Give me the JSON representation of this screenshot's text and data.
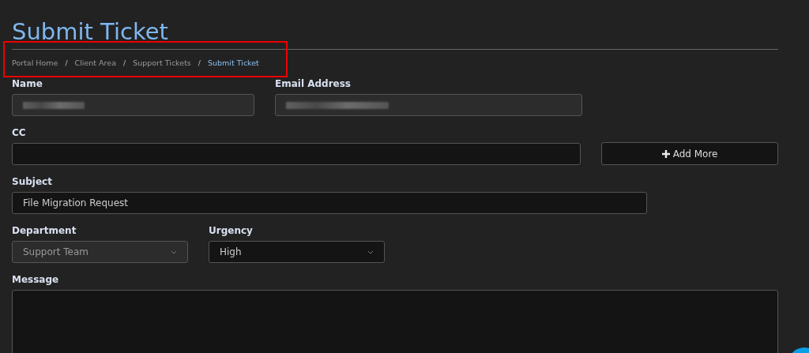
{
  "title": "Submit Ticket",
  "breadcrumb": [
    {
      "label": "Portal Home",
      "selected": false
    },
    {
      "label": "Client Area",
      "selected": false
    },
    {
      "label": "Support Tickets",
      "selected": false
    },
    {
      "label": "Submit Ticket",
      "selected": true
    }
  ],
  "breadcrumb_separator": "/",
  "form": {
    "name": {
      "label": "Name",
      "redacted": true
    },
    "email": {
      "label": "Email Address",
      "redacted": true
    },
    "cc": {
      "label": "CC",
      "button": "Add More"
    },
    "subject": {
      "label": "Subject",
      "value": "File Migration Request"
    },
    "department": {
      "label": "Department",
      "value": "Support Team",
      "disabled": true
    },
    "urgency": {
      "label": "Urgency",
      "value": "High",
      "disabled": false
    },
    "message": {
      "label": "Message"
    }
  }
}
